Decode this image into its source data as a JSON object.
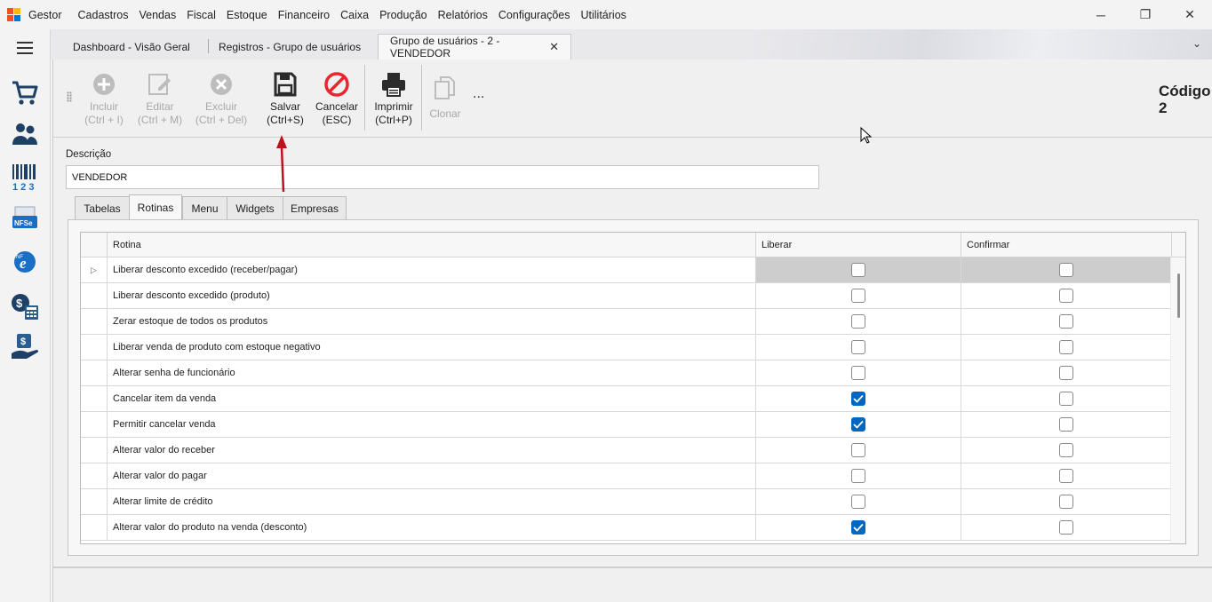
{
  "app": {
    "name": "Gestor"
  },
  "menu": [
    "Cadastros",
    "Vendas",
    "Fiscal",
    "Estoque",
    "Financeiro",
    "Caixa",
    "Produção",
    "Relatórios",
    "Configurações",
    "Utilitários"
  ],
  "window_controls": {
    "minimize": "─",
    "restore": "❐",
    "close": "✕"
  },
  "doc_tabs": [
    {
      "label": "Dashboard - Visão Geral"
    },
    {
      "label": "Registros - Grupo de usuários"
    },
    {
      "label": "Grupo de usuários - 2 - VENDEDOR",
      "close": "✕"
    }
  ],
  "tabs_dropdown": "⌄",
  "toolbar": {
    "incluir": {
      "line1": "Incluir",
      "line2": "(Ctrl + I)"
    },
    "editar": {
      "line1": "Editar",
      "line2": "(Ctrl + M)"
    },
    "excluir": {
      "line1": "Excluir",
      "line2": "(Ctrl + Del)"
    },
    "salvar": {
      "line1": "Salvar",
      "line2": "(Ctrl+S)"
    },
    "cancelar": {
      "line1": "Cancelar",
      "line2": "(ESC)"
    },
    "imprimir": {
      "line1": "Imprimir",
      "line2": "(Ctrl+P)"
    },
    "clonar": {
      "line1": "Clonar"
    },
    "more": "..."
  },
  "codigo": {
    "label": "Código",
    "value": "2"
  },
  "descricao": {
    "label": "Descrição",
    "value": "VENDEDOR"
  },
  "inner_tabs": [
    "Tabelas",
    "Rotinas",
    "Menu",
    "Widgets",
    "Empresas"
  ],
  "grid": {
    "columns": [
      "Rotina",
      "Liberar",
      "Confirmar"
    ],
    "indicator": "▷",
    "rows": [
      {
        "rotina": "Liberar desconto excedido (receber/pagar)",
        "liberar": false,
        "confirmar": false
      },
      {
        "rotina": "Liberar desconto excedido (produto)",
        "liberar": false,
        "confirmar": false
      },
      {
        "rotina": "Zerar estoque de todos os produtos",
        "liberar": false,
        "confirmar": false
      },
      {
        "rotina": "Liberar venda de produto com estoque negativo",
        "liberar": false,
        "confirmar": false
      },
      {
        "rotina": "Alterar senha de funcionário",
        "liberar": false,
        "confirmar": false
      },
      {
        "rotina": "Cancelar item da venda",
        "liberar": true,
        "confirmar": false
      },
      {
        "rotina": "Permitir cancelar venda",
        "liberar": true,
        "confirmar": false
      },
      {
        "rotina": "Alterar valor do receber",
        "liberar": false,
        "confirmar": false
      },
      {
        "rotina": "Alterar valor do pagar",
        "liberar": false,
        "confirmar": false
      },
      {
        "rotina": "Alterar limite de crédito",
        "liberar": false,
        "confirmar": false
      },
      {
        "rotina": "Alterar valor do produto na venda (desconto)",
        "liberar": true,
        "confirmar": false
      }
    ]
  },
  "sidebar_icons": [
    "menu-icon",
    "cart-icon",
    "users-icon",
    "barcode-icon",
    "nfse-icon",
    "nfe-icon",
    "finance-icon",
    "cash-hand-icon"
  ],
  "colors": {
    "accent": "#0067c0",
    "annotation_arrow": "#c0111f"
  }
}
